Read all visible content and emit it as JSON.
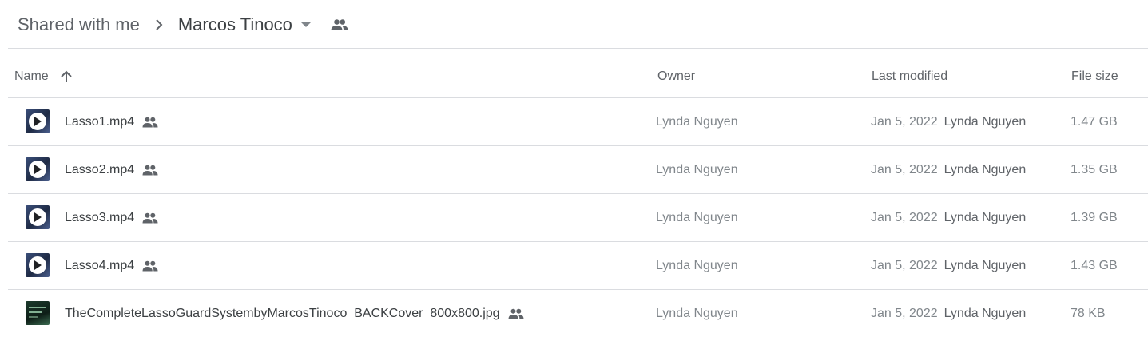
{
  "breadcrumb": {
    "root": "Shared with me",
    "current": "Marcos Tinoco"
  },
  "icons": {
    "separator": "chevron-right-icon",
    "caret": "arrow-drop-down-icon",
    "shared": "people-icon",
    "sort": "arrow-upward-icon",
    "play": "play-icon"
  },
  "colors": {
    "text": "#3c4043",
    "muted": "#80868b",
    "divider": "#dadce0"
  },
  "table": {
    "columns": {
      "name": "Name",
      "owner": "Owner",
      "last_modified": "Last modified",
      "file_size": "File size"
    },
    "sort": "ascending",
    "rows": [
      {
        "name": "Lasso1.mp4",
        "type": "video",
        "owner": "Lynda Nguyen",
        "modified_date": "Jan 5, 2022",
        "modified_by": "Lynda Nguyen",
        "size": "1.47 GB"
      },
      {
        "name": "Lasso2.mp4",
        "type": "video",
        "owner": "Lynda Nguyen",
        "modified_date": "Jan 5, 2022",
        "modified_by": "Lynda Nguyen",
        "size": "1.35 GB"
      },
      {
        "name": "Lasso3.mp4",
        "type": "video",
        "owner": "Lynda Nguyen",
        "modified_date": "Jan 5, 2022",
        "modified_by": "Lynda Nguyen",
        "size": "1.39 GB"
      },
      {
        "name": "Lasso4.mp4",
        "type": "video",
        "owner": "Lynda Nguyen",
        "modified_date": "Jan 5, 2022",
        "modified_by": "Lynda Nguyen",
        "size": "1.43 GB"
      },
      {
        "name": "TheCompleteLassoGuardSystembyMarcosTinoco_BACKCover_800x800.jpg",
        "type": "image",
        "owner": "Lynda Nguyen",
        "modified_date": "Jan 5, 2022",
        "modified_by": "Lynda Nguyen",
        "size": "78 KB"
      }
    ]
  }
}
